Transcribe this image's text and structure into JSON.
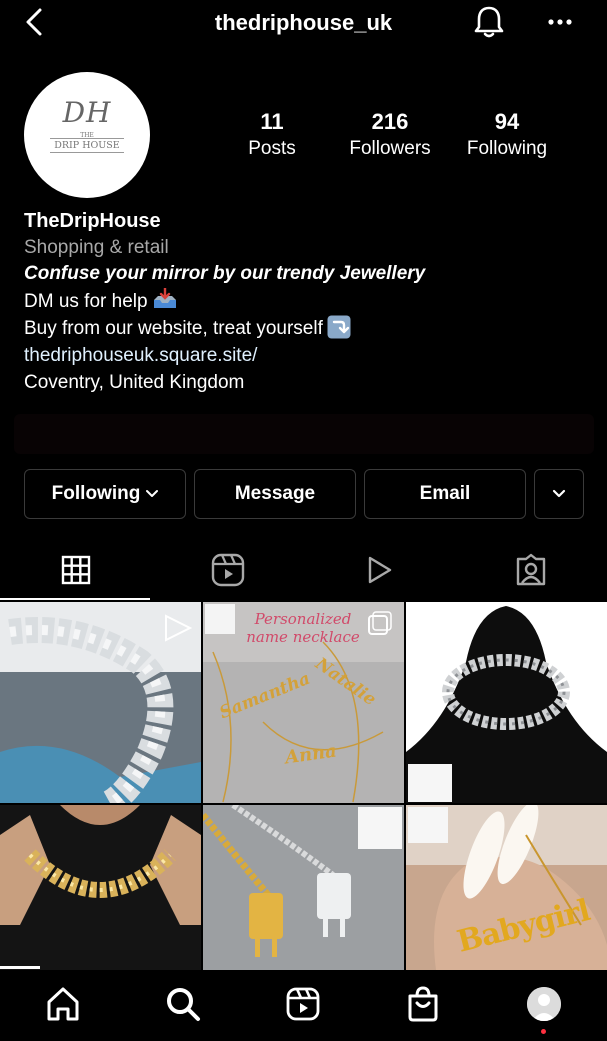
{
  "header": {
    "username": "thedriphouse_uk"
  },
  "profile": {
    "avatar_logo": {
      "monogram": "DH",
      "the": "THE",
      "name": "DRIP HOUSE"
    },
    "stats": [
      {
        "value": "11",
        "label": "Posts"
      },
      {
        "value": "216",
        "label": "Followers"
      },
      {
        "value": "94",
        "label": "Following"
      }
    ],
    "display_name": "TheDripHouse",
    "category": "Shopping & retail",
    "bio_lines": {
      "tagline": "Confuse your mirror by our trendy Jewellery",
      "dm": "DM us for help",
      "website_line": "Buy from our website, treat yourself",
      "link": "thedriphouseuk.square.site/",
      "location": "Coventry, United Kingdom"
    }
  },
  "actions": {
    "following_label": "Following",
    "message_label": "Message",
    "email_label": "Email"
  },
  "tabs": [
    "grid-icon",
    "reels-icon",
    "videos-icon",
    "tagged-icon"
  ],
  "posts": {
    "p2_banner": "Personalized name necklace",
    "p2_names": [
      "Samantha",
      "Natalie",
      "Anna"
    ],
    "p6_text": "Babygirl"
  },
  "bottom_nav": [
    "home-icon",
    "search-icon",
    "reels-icon",
    "shop-icon",
    "profile-avatar"
  ],
  "colors": {
    "background": "#000000",
    "link": "#e0f1ff",
    "secondary_text": "#a8a8a8",
    "notification_dot": "#ff3040"
  }
}
